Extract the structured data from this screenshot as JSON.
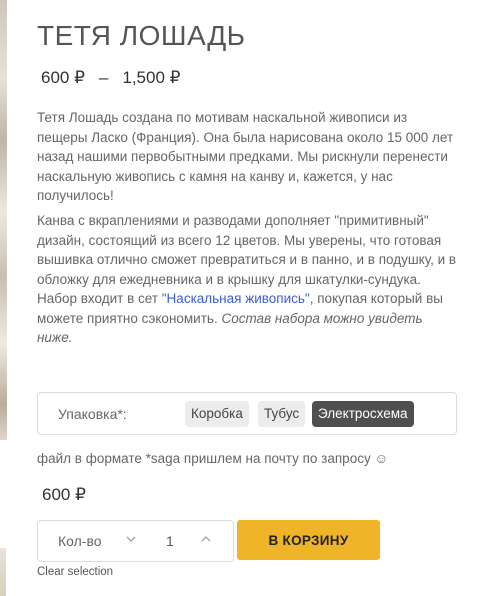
{
  "product": {
    "title": "ТЕТЯ ЛОШАДЬ",
    "price_min": "600 ₽",
    "price_sep": "–",
    "price_max": "1,500 ₽",
    "description_p1": "Тетя Лошадь создана по мотивам наскальной живописи из пещеры Ласко (Франция). Она была нарисована около 15 000 лет назад нашими первобытными предками. Мы рискнули перенести наскальную живопись с камня на канву и, кажется, у нас получилось!",
    "description_p2_before_link": "Канва с вкраплениями и разводами дополняет \"примитивный\" дизайн, состоящий из всего 12 цветов. Мы уверены, что готовая вышивка отлично сможет превратиться и в панно, и в подушку, и в обложку для ежедневника и в крышку для шкатулки-сундука. Набор входит в сет ",
    "description_p2_link": "\"Наскальная живопись\"",
    "description_p2_after_link": ", покупая который вы можете приятно сэкономить. ",
    "description_p2_italic": "Состав набора можно увидеть ниже."
  },
  "variation": {
    "label": "Упаковка*:",
    "options": [
      "Коробка",
      "Тубус",
      "Электросхема"
    ],
    "selected": "Электросхема"
  },
  "note": "файл в формате *saga пришлем на почту по запросу ☺",
  "selected_price": "600 ₽",
  "quantity": {
    "label": "Кол-во",
    "value": "1",
    "decrease_icon": "chevron-down-icon",
    "increase_icon": "chevron-up-icon"
  },
  "add_to_cart_label": "В КОРЗИНУ",
  "clear_selection_label": "Clear selection",
  "colors": {
    "accent": "#f0b429",
    "link": "#3b5bdb",
    "selected_swatch": "#4f4f4f"
  }
}
